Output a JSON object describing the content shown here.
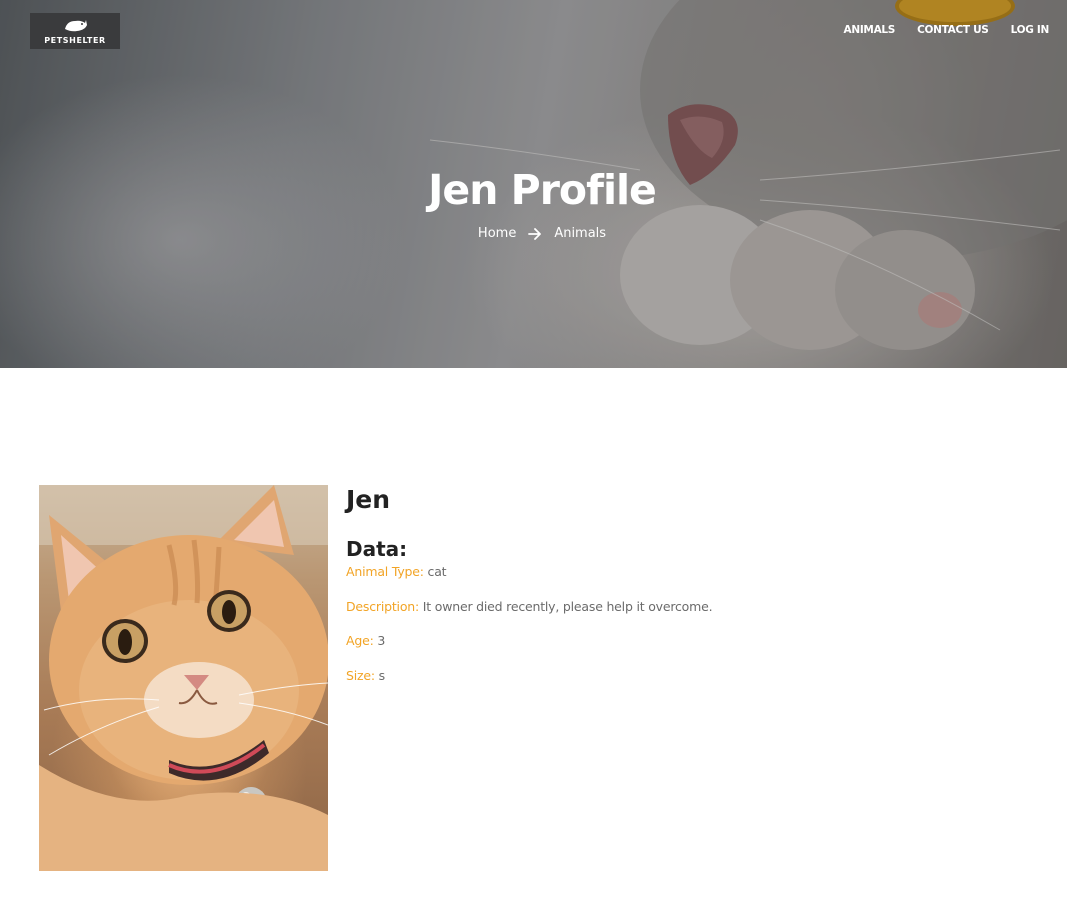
{
  "brand": {
    "name": "PETSHELTER"
  },
  "nav": [
    {
      "label": "ANIMALS"
    },
    {
      "label": "CONTACT US"
    },
    {
      "label": "LOG IN"
    }
  ],
  "hero": {
    "title": "Jen Profile",
    "breadcrumb": {
      "home": "Home",
      "current": "Animals"
    }
  },
  "animal": {
    "name": "Jen",
    "data_heading": "Data:",
    "fields": [
      {
        "key": "Animal Type:",
        "value": "cat"
      },
      {
        "key": "Description:",
        "value": "It owner died recently, please help it overcome."
      },
      {
        "key": "Age:",
        "value": "3"
      },
      {
        "key": "Size:",
        "value": "s"
      }
    ]
  },
  "colors": {
    "accent": "#f2a426",
    "text": "#222222",
    "muted": "#6b6b6b"
  },
  "icons": [
    "dog-cat-logo-icon",
    "arrow-right-icon"
  ]
}
